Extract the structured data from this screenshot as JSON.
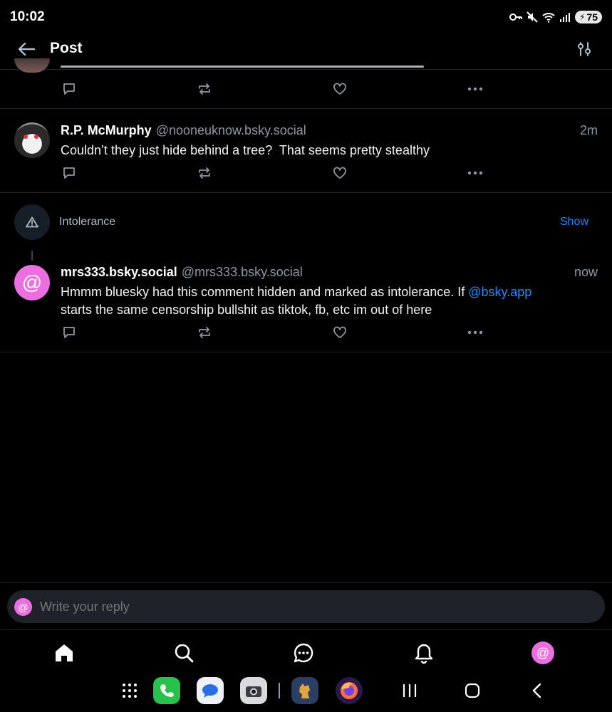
{
  "status_bar": {
    "time": "10:02",
    "battery": "75"
  },
  "header": {
    "title": "Post"
  },
  "posts": [
    {
      "actions": [
        "reply",
        "repost",
        "like",
        "more"
      ]
    },
    {
      "author": "R.P. McMurphy",
      "handle": "@nooneuknow.bsky.social",
      "time": "2m",
      "text": "Couldn’t they just hide behind a tree?  That seems pretty stealthy"
    },
    {
      "warning_label": "Intolerance",
      "show_label": "Show",
      "author": "mrs333.bsky.social",
      "handle": "@mrs333.bsky.social",
      "time": "now",
      "text_before": "Hmmm bluesky had this comment hidden and marked as intolerance. If ",
      "mention": "@bsky.app",
      "text_after": "starts the same censorship bullshit as tiktok, fb, etc im out of here"
    }
  ],
  "reply": {
    "placeholder": "Write your reply"
  },
  "tab_bar": [
    "home-icon",
    "search-icon",
    "chat-icon",
    "bell-icon",
    "profile-avatar"
  ],
  "colors": {
    "accent": "#208bfe",
    "avatar_pink": "#ec6ee0",
    "divider": "#1e2329"
  }
}
